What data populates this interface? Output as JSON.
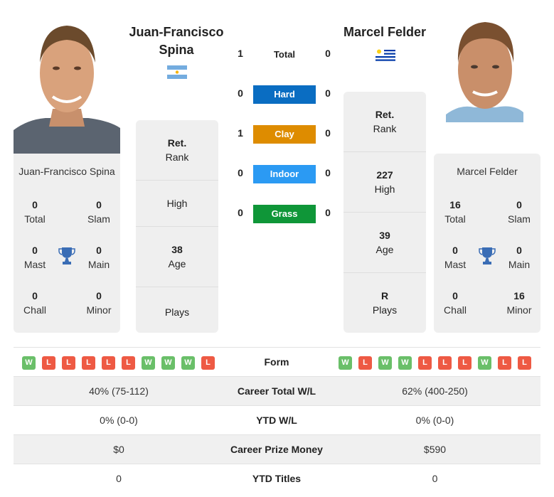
{
  "player_left": {
    "name": "Juan-Francisco Spina",
    "name_line1": "Juan-Francisco",
    "name_line2": "Spina",
    "country_flag": "argentina-flag",
    "card_name": "Juan-Francisco Spina",
    "titles": {
      "total": {
        "value": "0",
        "label": "Total"
      },
      "slam": {
        "value": "0",
        "label": "Slam"
      },
      "mast": {
        "value": "0",
        "label": "Mast"
      },
      "main": {
        "value": "0",
        "label": "Main"
      },
      "chall": {
        "value": "0",
        "label": "Chall"
      },
      "minor": {
        "value": "0",
        "label": "Minor"
      }
    },
    "rank": {
      "value": "Ret.",
      "label": "Rank"
    },
    "high": {
      "value": "",
      "label": "High"
    },
    "age": {
      "value": "38",
      "label": "Age"
    },
    "plays": {
      "value": "",
      "label": "Plays"
    },
    "form": [
      "W",
      "L",
      "L",
      "L",
      "L",
      "L",
      "W",
      "W",
      "W",
      "L"
    ]
  },
  "player_right": {
    "name": "Marcel Felder",
    "country_flag": "uruguay-flag",
    "card_name": "Marcel Felder",
    "titles": {
      "total": {
        "value": "16",
        "label": "Total"
      },
      "slam": {
        "value": "0",
        "label": "Slam"
      },
      "mast": {
        "value": "0",
        "label": "Mast"
      },
      "main": {
        "value": "0",
        "label": "Main"
      },
      "chall": {
        "value": "0",
        "label": "Chall"
      },
      "minor": {
        "value": "16",
        "label": "Minor"
      }
    },
    "rank": {
      "value": "Ret.",
      "label": "Rank"
    },
    "high": {
      "value": "227",
      "label": "High"
    },
    "age": {
      "value": "39",
      "label": "Age"
    },
    "plays": {
      "value": "R",
      "label": "Plays"
    },
    "form": [
      "W",
      "L",
      "W",
      "W",
      "L",
      "L",
      "L",
      "W",
      "L",
      "L"
    ]
  },
  "h2h": {
    "total": {
      "label": "Total",
      "left": "1",
      "right": "0"
    },
    "surfaces": [
      {
        "label": "Hard",
        "left": "0",
        "right": "0",
        "color": "#0a6dc2"
      },
      {
        "label": "Clay",
        "left": "1",
        "right": "0",
        "color": "#de8c00"
      },
      {
        "label": "Indoor",
        "left": "0",
        "right": "0",
        "color": "#2b9af3"
      },
      {
        "label": "Grass",
        "left": "0",
        "right": "0",
        "color": "#0f9638"
      }
    ]
  },
  "comparison": {
    "form_label": "Form",
    "rows": [
      {
        "label": "Career Total W/L",
        "left": "40% (75-112)",
        "right": "62% (400-250)"
      },
      {
        "label": "YTD W/L",
        "left": "0% (0-0)",
        "right": "0% (0-0)"
      },
      {
        "label": "Career Prize Money",
        "left": "$0",
        "right": "$590"
      },
      {
        "label": "YTD Titles",
        "left": "0",
        "right": "0"
      }
    ]
  },
  "colors": {
    "win": "#6abf69",
    "loss": "#ee5a44",
    "trophy": "#3a6db5",
    "card_bg": "#efefef"
  }
}
